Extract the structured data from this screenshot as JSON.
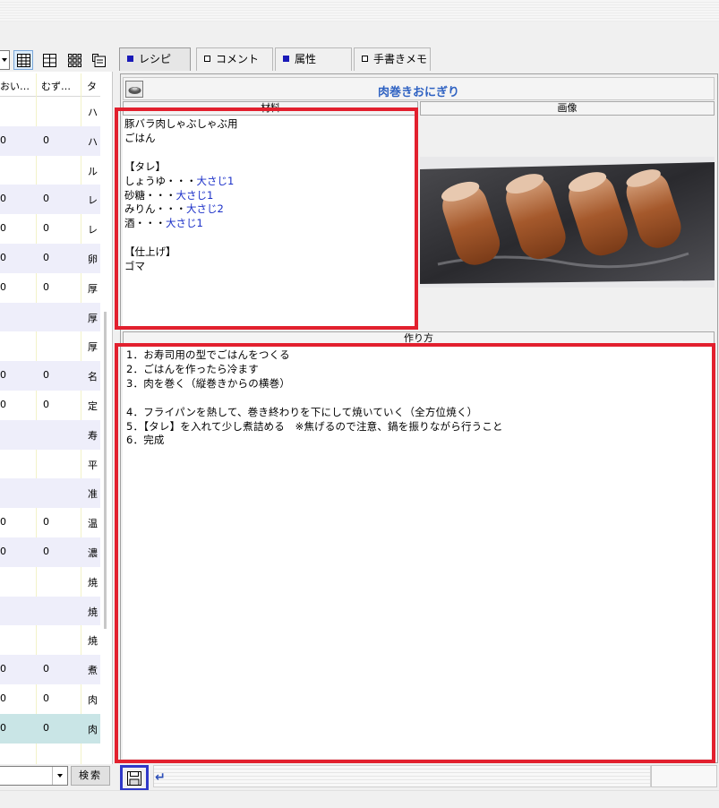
{
  "tabs": [
    {
      "label": "レシピ",
      "marker": "filled"
    },
    {
      "label": "コメント",
      "marker": "hollow"
    },
    {
      "label": "属性",
      "marker": "filled"
    },
    {
      "label": "手書きメモ",
      "marker": "hollow"
    }
  ],
  "recipe": {
    "title": "肉巻きおにぎり",
    "ingredients_header": "材料",
    "image_header": "画像",
    "method_header": "作り方",
    "ingredients": [
      {
        "text": "豚バラ肉しゃぶしゃぶ用",
        "amount": ""
      },
      {
        "text": "ごはん",
        "amount": ""
      },
      {
        "text": "",
        "amount": ""
      },
      {
        "text": "【タレ】",
        "amount": ""
      },
      {
        "text": "しょうゆ・・・",
        "amount": "大さじ1"
      },
      {
        "text": "砂糖・・・",
        "amount": "大さじ1"
      },
      {
        "text": "みりん・・・",
        "amount": "大さじ2"
      },
      {
        "text": "酒・・・",
        "amount": "大さじ1"
      },
      {
        "text": "",
        "amount": ""
      },
      {
        "text": "【仕上げ】",
        "amount": ""
      },
      {
        "text": "ゴマ",
        "amount": ""
      }
    ],
    "method": [
      "1．お寿司用の型でごはんをつくる",
      "2．ごはんを作ったら冷ます",
      "3．肉を巻く（縦巻きからの横巻）",
      "",
      "4．フライパンを熱して、巻き終わりを下にして焼いていく（全方位焼く）",
      "5．【タレ】を入れて少し煮詰める　※焦げるので注意、鍋を振りながら行うこと",
      "6．完成"
    ]
  },
  "list": {
    "headers": [
      "おい…",
      "むず…",
      "タ"
    ],
    "rows": [
      [
        "",
        "",
        "ハ"
      ],
      [
        "0",
        "0",
        "ハ"
      ],
      [
        "",
        "",
        "ル"
      ],
      [
        "0",
        "0",
        "レ"
      ],
      [
        "0",
        "0",
        "レ"
      ],
      [
        "0",
        "0",
        "卵"
      ],
      [
        "0",
        "0",
        "厚"
      ],
      [
        "",
        "",
        "厚"
      ],
      [
        "",
        "",
        "厚"
      ],
      [
        "0",
        "0",
        "名"
      ],
      [
        "0",
        "0",
        "定"
      ],
      [
        "",
        "",
        "寿"
      ],
      [
        "",
        "",
        "平"
      ],
      [
        "",
        "",
        "准"
      ],
      [
        "0",
        "0",
        "温"
      ],
      [
        "0",
        "0",
        "濃"
      ],
      [
        "",
        "",
        "焼"
      ],
      [
        "",
        "",
        "焼"
      ],
      [
        "",
        "",
        "焼"
      ],
      [
        "0",
        "0",
        "煮"
      ],
      [
        "0",
        "0",
        "肉"
      ],
      [
        "0",
        "0",
        "肉"
      ]
    ],
    "selected_index": 21
  },
  "search": {
    "button_label": "検索",
    "value": ""
  },
  "bottom": {
    "enter_symbol": "↵"
  },
  "icons": [
    "dropdown-arrow-icon",
    "details-grid-icon",
    "list-columns-icon",
    "thumbnail-grid-icon",
    "card-view-icon",
    "dish-icon",
    "save-icon",
    "enter-icon"
  ],
  "colors": {
    "highlight_frame": "#e2202e",
    "save_frame": "#2f38c8",
    "title": "#2f62c2",
    "amount": "#1b30c8"
  }
}
